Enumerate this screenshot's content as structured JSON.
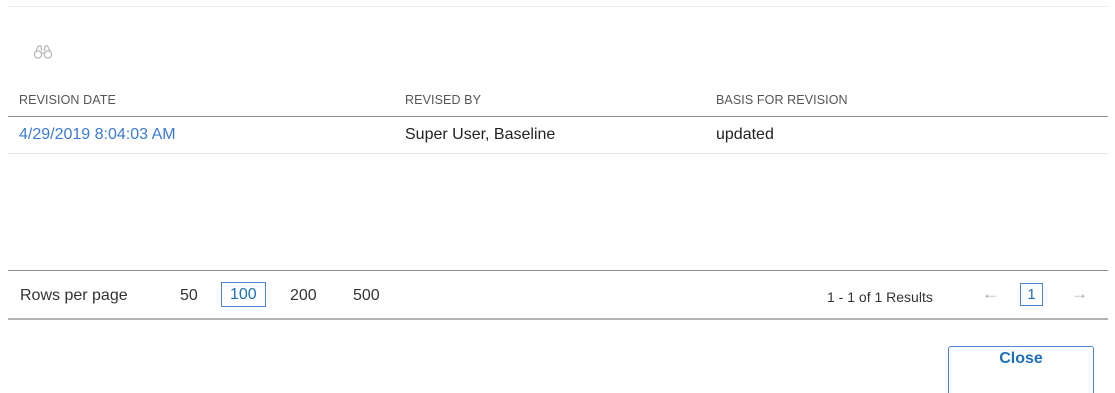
{
  "toolbar": {
    "search_icon": "binoculars-icon"
  },
  "table": {
    "columns": [
      "REVISION DATE",
      "REVISED BY",
      "BASIS FOR REVISION"
    ],
    "rows": [
      [
        "4/29/2019 8:04:03 AM",
        "Super User, Baseline",
        "updated"
      ]
    ]
  },
  "pager": {
    "rows_per_page_label": "Rows per page",
    "options": [
      "50",
      "100",
      "200",
      "500"
    ],
    "selected_option": "100",
    "results_text": "1 - 1 of 1 Results",
    "prev_icon": "arrow-left-icon",
    "next_icon": "arrow-right-icon",
    "prev_glyph": "←",
    "next_glyph": "→",
    "current_page": "1"
  },
  "footer": {
    "close_label": "Close"
  },
  "colors": {
    "link": "#3b7bd4",
    "accent": "#1d6fb8",
    "accent_border": "#4a86cc"
  }
}
